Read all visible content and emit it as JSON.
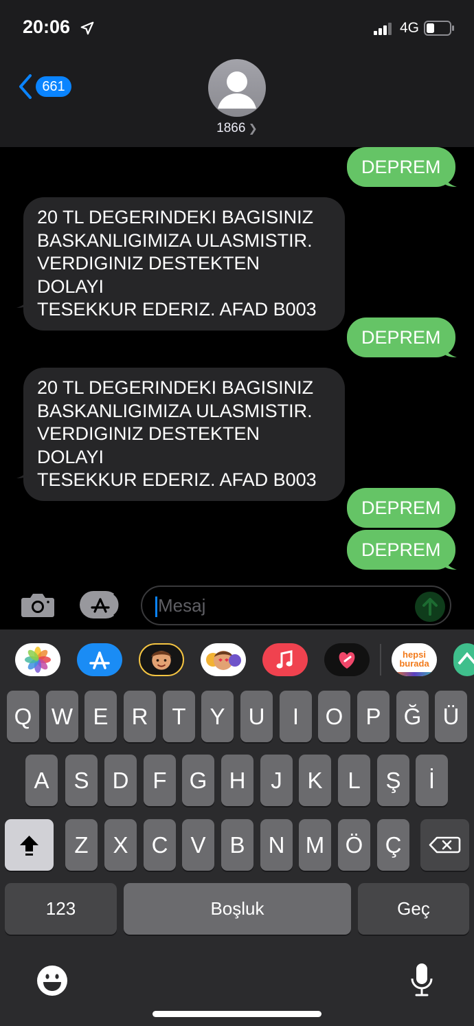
{
  "status_bar": {
    "time": "20:06",
    "network": "4G"
  },
  "header": {
    "back_count": "661",
    "contact": "1866"
  },
  "messages": [
    {
      "type": "sent",
      "text": "DEPREM"
    },
    {
      "type": "received",
      "lines": [
        "20 TL DEGERINDEKI BAGISINIZ",
        "BASKANLIGIMIZA ULASMISTIR.",
        "VERDIGINIZ DESTEKTEN DOLAYI",
        "TESEKKUR EDERIZ. AFAD B003"
      ]
    },
    {
      "type": "sent",
      "text": "DEPREM"
    },
    {
      "type": "received",
      "lines": [
        "20 TL DEGERINDEKI BAGISINIZ",
        "BASKANLIGIMIZA ULASMISTIR.",
        "VERDIGINIZ DESTEKTEN DOLAYI",
        "TESEKKUR EDERIZ. AFAD B003"
      ]
    },
    {
      "type": "sent",
      "text": "DEPREM"
    },
    {
      "type": "sent",
      "text": "DEPREM"
    }
  ],
  "input": {
    "placeholder": "Mesaj"
  },
  "app_strip": [
    {
      "icon": "photos-icon"
    },
    {
      "icon": "app-store-icon"
    },
    {
      "icon": "memoji-icon"
    },
    {
      "icon": "memoji-stickers-icon"
    },
    {
      "icon": "music-icon"
    },
    {
      "icon": "digital-touch-icon"
    },
    {
      "icon": "hepsiburada-icon",
      "label_top": "hepsi",
      "label_bottom": "burada"
    },
    {
      "icon": "app-partial-icon"
    }
  ],
  "keyboard": {
    "row1": [
      "Q",
      "W",
      "E",
      "R",
      "T",
      "Y",
      "U",
      "I",
      "O",
      "P",
      "Ğ",
      "Ü"
    ],
    "row2": [
      "A",
      "S",
      "D",
      "F",
      "G",
      "H",
      "J",
      "K",
      "L",
      "Ş",
      "İ"
    ],
    "row3": [
      "Z",
      "X",
      "C",
      "V",
      "B",
      "N",
      "M",
      "Ö",
      "Ç"
    ],
    "numbers_label": "123",
    "space_label": "Boşluk",
    "return_label": "Geç"
  },
  "colors": {
    "sent_bubble": "#65c466",
    "received_bubble": "#262628",
    "accent": "#0a84ff"
  }
}
